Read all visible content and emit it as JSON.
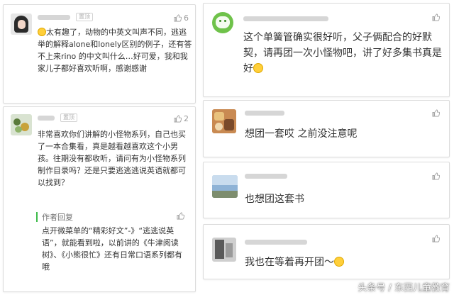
{
  "comments": {
    "c1": {
      "badge": "置顶",
      "likes": "6",
      "text": "太有趣了，动物的中英文叫声不同，逃逃举的解释alone和lonely区别的例子，还有答不上来rino 的中文叫什么…好可爱，我和我家儿子都好喜欢听啊，感谢感谢"
    },
    "c2": {
      "badge": "置顶",
      "likes": "2",
      "text": "非常喜欢你们讲解的小怪物系列，自己也买了一本合集看，真是越看越喜欢这个小男孩。往期没有都收听，请问有为小怪物系列制作目录吗？还是只要逃逃逃说英语就都可以找到？",
      "reply_label": "作者回复",
      "reply_text": "点开微菜单的“精彩好文”-》“逃逃说英语”，就能看到啦，以前讲的《牛津阅读树》、《小熊很忙》还有日常口语系列都有哦"
    },
    "c3": {
      "text": "这个单簧管确实很好听，父子俩配合的好默契，请再团一次小怪物吧，讲了好多集书真是好"
    },
    "c4": {
      "text": "想团一套哎 之前没注意呢"
    },
    "c5": {
      "text": "也想团这套书"
    },
    "c6": {
      "text": "我也在等着再开团～"
    }
  },
  "watermark": "头条号 / 东西儿童教育",
  "colors": {
    "accent_green": "#3dbb4a",
    "muted": "#9a9a9a"
  }
}
